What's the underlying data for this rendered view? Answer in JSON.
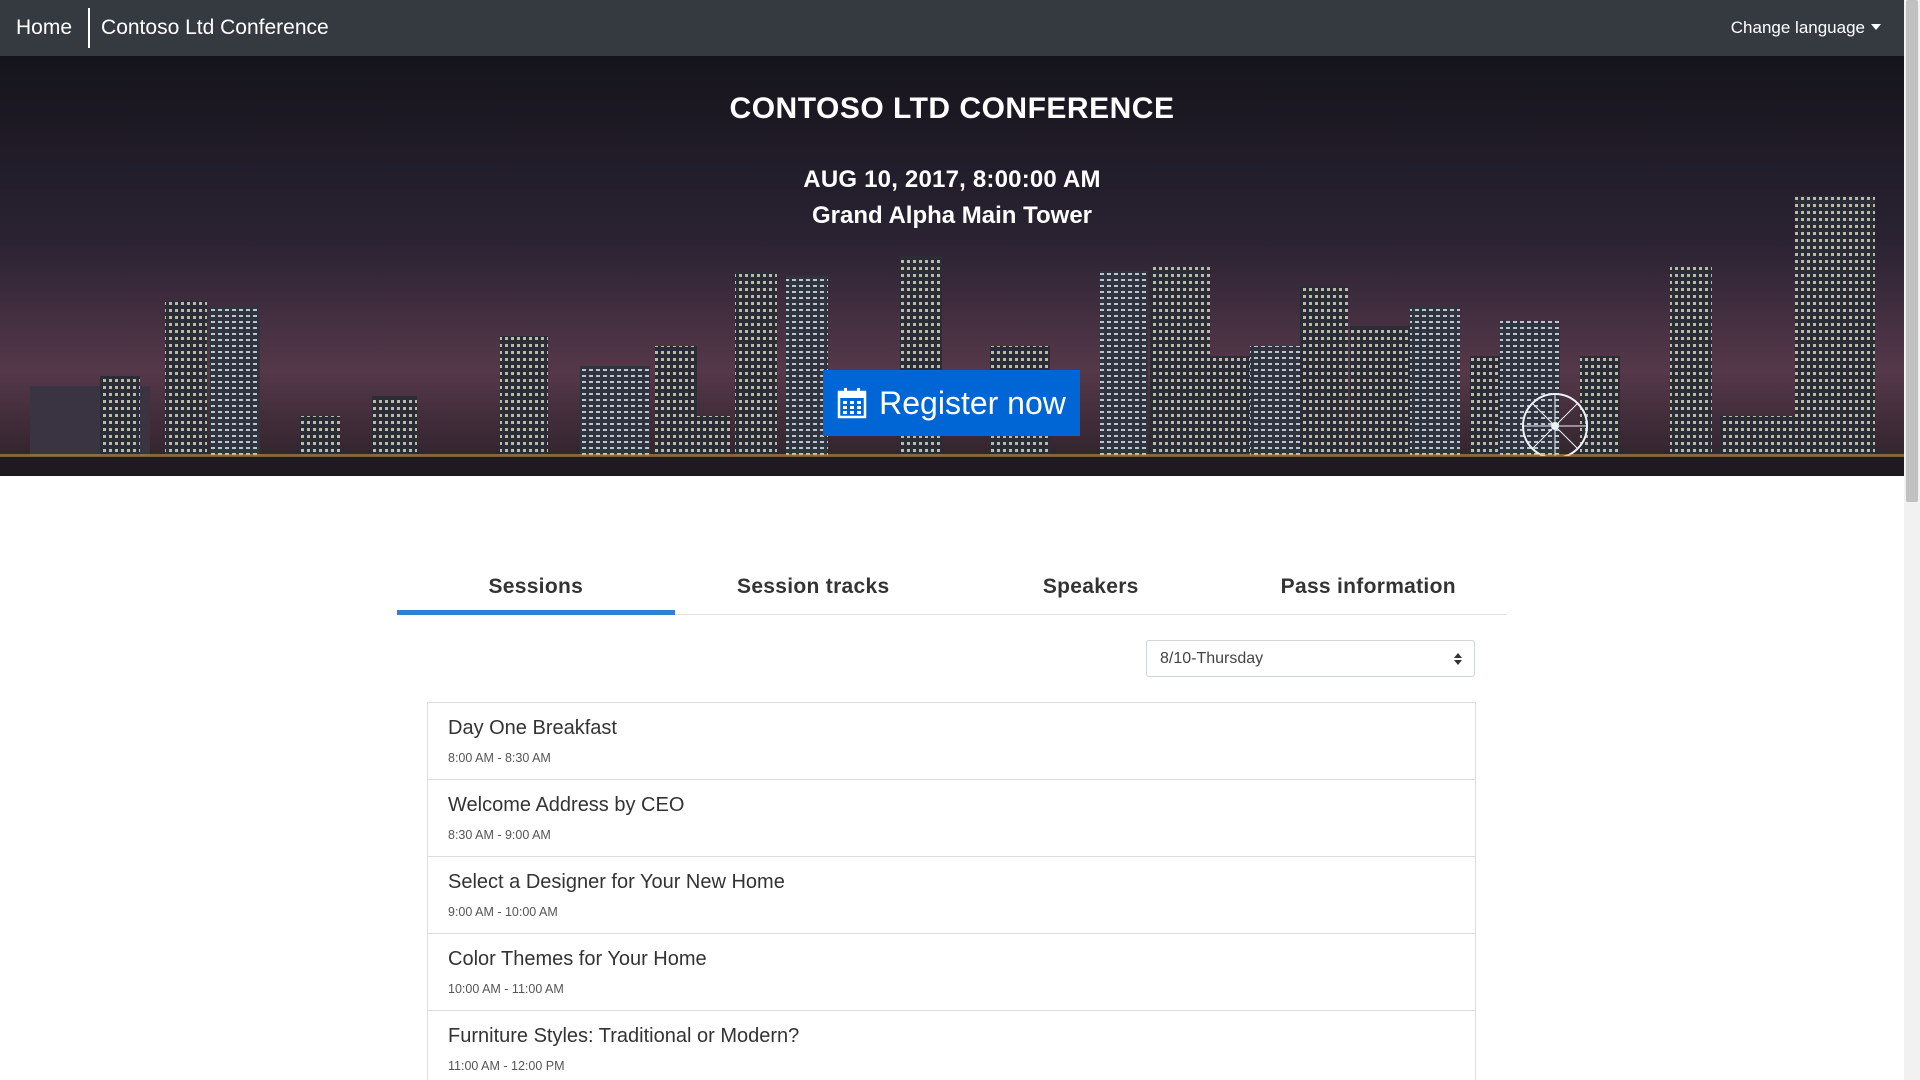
{
  "nav": {
    "home_label": "Home",
    "site_title": "Contoso Ltd Conference",
    "language_label": "Change language"
  },
  "hero": {
    "title": "CONTOSO LTD CONFERENCE",
    "date": "AUG 10, 2017, 8:00:00 AM",
    "venue": "Grand Alpha Main Tower",
    "register_label": "Register now",
    "register_icon": "calendar-icon",
    "button_color": "#0066d6"
  },
  "tabs": [
    {
      "label": "Sessions",
      "active": true
    },
    {
      "label": "Session tracks",
      "active": false
    },
    {
      "label": "Speakers",
      "active": false
    },
    {
      "label": "Pass information",
      "active": false
    }
  ],
  "day_select": {
    "value": "8/10-Thursday"
  },
  "sessions": [
    {
      "title": "Day One Breakfast",
      "time": "8:00 AM - 8:30 AM"
    },
    {
      "title": "Welcome Address by CEO",
      "time": "8:30 AM - 9:00 AM"
    },
    {
      "title": "Select a Designer for Your New Home",
      "time": "9:00 AM - 10:00 AM"
    },
    {
      "title": "Color Themes for Your Home",
      "time": "10:00 AM - 11:00 AM"
    },
    {
      "title": "Furniture Styles: Traditional or Modern?",
      "time": "11:00 AM - 12:00 PM"
    }
  ],
  "colors": {
    "navbar": "#343a40",
    "tab_underline": "#2f7fd6"
  }
}
